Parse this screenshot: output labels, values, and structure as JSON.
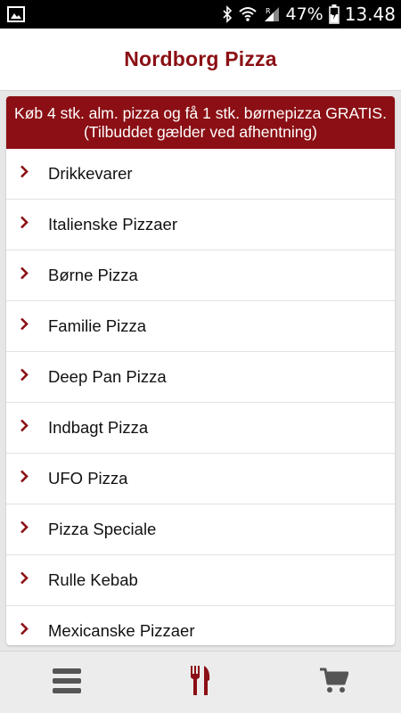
{
  "status_bar": {
    "battery_percent": "47%",
    "time": "13.48",
    "icons": [
      "image-notification-icon",
      "bluetooth-icon",
      "wifi-icon",
      "signal-icon",
      "battery-icon"
    ]
  },
  "app_bar": {
    "title": "Nordborg Pizza"
  },
  "banner": {
    "text": "Køb 4 stk. alm. pizza og få 1 stk. børnepizza GRATIS. (Tilbuddet gælder ved afhentning)"
  },
  "menu": {
    "items": [
      {
        "label": "Drikkevarer"
      },
      {
        "label": "Italienske Pizzaer"
      },
      {
        "label": "Børne Pizza"
      },
      {
        "label": "Familie Pizza"
      },
      {
        "label": "Deep Pan Pizza"
      },
      {
        "label": "Indbagt Pizza"
      },
      {
        "label": "UFO Pizza"
      },
      {
        "label": "Pizza Speciale"
      },
      {
        "label": "Rulle Kebab"
      },
      {
        "label": "Mexicanske Pizzaer"
      }
    ]
  },
  "bottom_nav": {
    "tabs": [
      {
        "icon": "hamburger-menu-icon",
        "active": false
      },
      {
        "icon": "fork-knife-icon",
        "active": true
      },
      {
        "icon": "shopping-cart-icon",
        "active": false
      }
    ]
  },
  "colors": {
    "brand": "#8b0f14",
    "inactive_icon": "#555555",
    "background": "#e7e7e7"
  }
}
